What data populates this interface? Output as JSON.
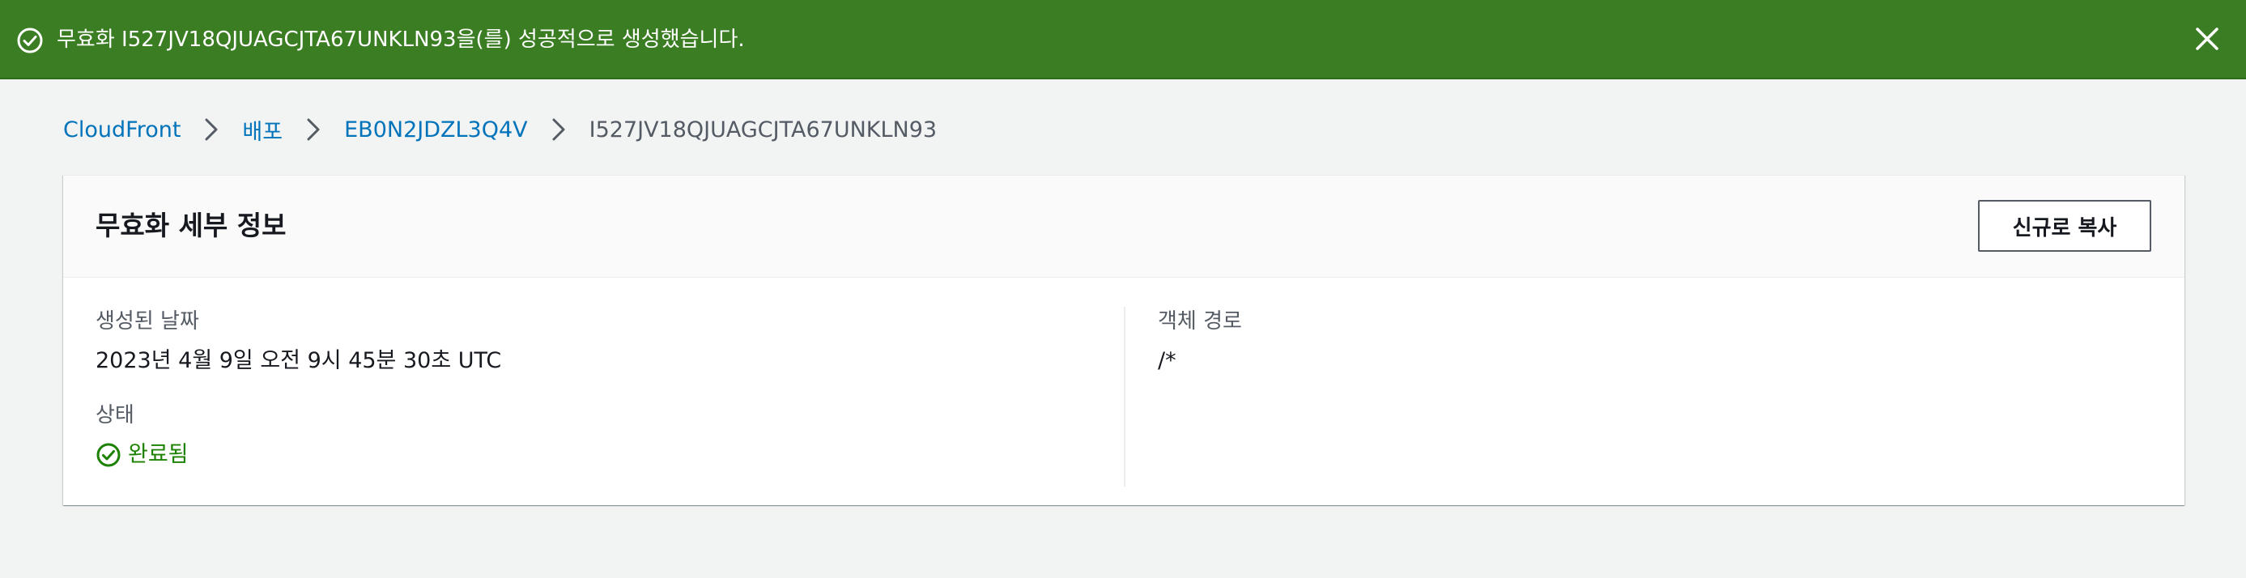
{
  "flash": {
    "message": "무효화 I527JV18QJUAGCJTA67UNKLN93을(를) 성공적으로 생성했습니다.",
    "icon": "check-circle-icon",
    "close_icon": "close-icon",
    "color": "#3b7d23"
  },
  "breadcrumb": {
    "items": [
      {
        "label": "CloudFront"
      },
      {
        "label": "배포"
      },
      {
        "label": "EB0N2JDZL3Q4V"
      }
    ],
    "current": "I527JV18QJUAGCJTA67UNKLN93",
    "separator_icon": "chevron-right-icon"
  },
  "panel": {
    "title": "무효화 세부 정보",
    "copy_button_label": "신규로 복사",
    "created": {
      "label": "생성된 날짜",
      "value": "2023년 4월 9일 오전 9시 45분 30초 UTC"
    },
    "status": {
      "label": "상태",
      "value": "완료됨",
      "icon": "status-success-icon",
      "color": "#1d8102"
    },
    "object_path": {
      "label": "객체 경로",
      "value": "/*"
    }
  }
}
